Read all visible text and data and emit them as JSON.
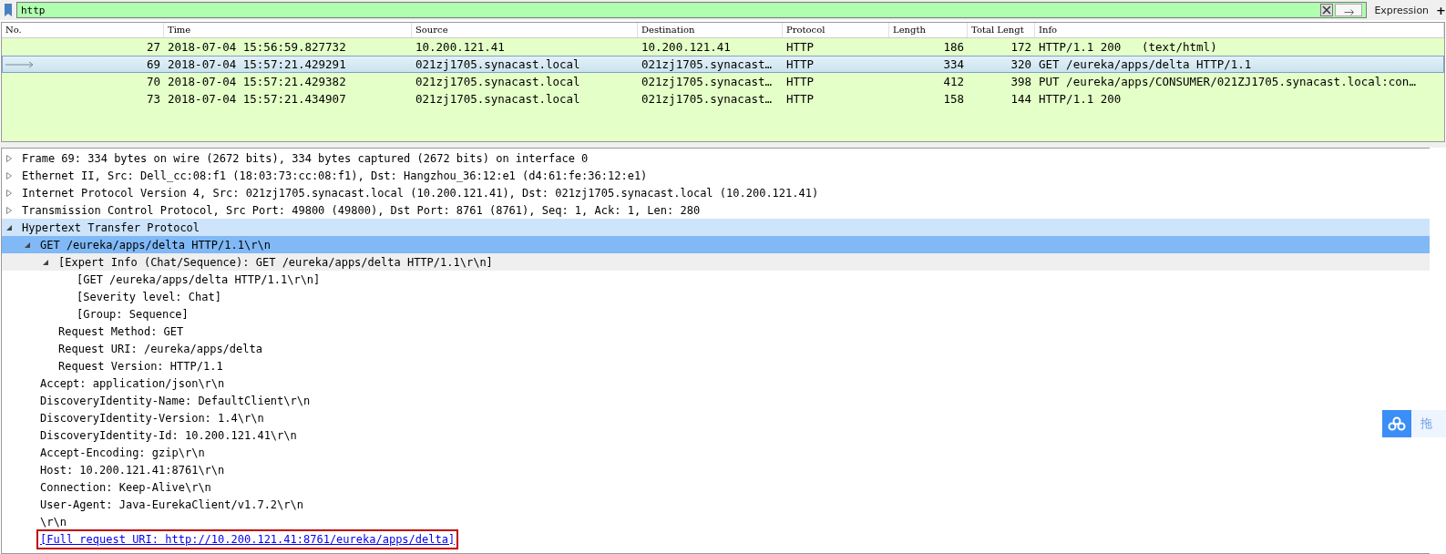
{
  "filter": {
    "value": "http",
    "expression_label": "Expression",
    "add_label": "+"
  },
  "packet_list": {
    "columns": [
      "No.",
      "Time",
      "Source",
      "Destination",
      "Protocol",
      "Length",
      "Total Lengt",
      "Info"
    ],
    "rows": [
      {
        "cells": [
          "27",
          "2018-07-04 15:56:59.827732",
          "10.200.121.41",
          "10.200.121.41",
          "HTTP",
          "186",
          "172",
          "HTTP/1.1 200   (text/html)"
        ],
        "selected": false
      },
      {
        "cells": [
          "69",
          "2018-07-04 15:57:21.429291",
          "021zj1705.synacast.local",
          "021zj1705.synacast…",
          "HTTP",
          "334",
          "320",
          "GET /eureka/apps/delta HTTP/1.1"
        ],
        "selected": true
      },
      {
        "cells": [
          "70",
          "2018-07-04 15:57:21.429382",
          "021zj1705.synacast.local",
          "021zj1705.synacast…",
          "HTTP",
          "412",
          "398",
          "PUT /eureka/apps/CONSUMER/021ZJ1705.synacast.local:con…"
        ],
        "selected": false
      },
      {
        "cells": [
          "73",
          "2018-07-04 15:57:21.434907",
          "021zj1705.synacast.local",
          "021zj1705.synacast…",
          "HTTP",
          "158",
          "144",
          "HTTP/1.1 200"
        ],
        "selected": false
      }
    ]
  },
  "details": [
    {
      "text": "Frame 69: 334 bytes on wire (2672 bits), 334 bytes captured (2672 bits) on interface 0",
      "expanded": false,
      "selected": false
    },
    {
      "text": "Ethernet II, Src: Dell_cc:08:f1 (18:03:73:cc:08:f1), Dst: Hangzhou_36:12:e1 (d4:61:fe:36:12:e1)",
      "expanded": false,
      "selected": false
    },
    {
      "text": "Internet Protocol Version 4, Src: 021zj1705.synacast.local (10.200.121.41), Dst: 021zj1705.synacast.local (10.200.121.41)",
      "expanded": false,
      "selected": false
    },
    {
      "text": "Transmission Control Protocol, Src Port: 49800 (49800), Dst Port: 8761 (8761), Seq: 1, Ack: 1, Len: 280",
      "expanded": false,
      "selected": false
    },
    {
      "text": "Hypertext Transfer Protocol",
      "expanded": true,
      "selected": false,
      "kind": "protocol",
      "children": [
        {
          "text": "GET /eureka/apps/delta HTTP/1.1\\r\\n",
          "expanded": true,
          "selected": true,
          "children": [
            {
              "text": "[Expert Info (Chat/Sequence): GET /eureka/apps/delta HTTP/1.1\\r\\n]",
              "expanded": true,
              "selected": false,
              "kind": "expert",
              "children": [
                {
                  "text": "[GET /eureka/apps/delta HTTP/1.1\\r\\n]",
                  "selected": false
                },
                {
                  "text": "[Severity level: Chat]",
                  "selected": false
                },
                {
                  "text": "[Group: Sequence]",
                  "selected": false
                }
              ]
            },
            {
              "text": "Request Method: GET",
              "selected": false
            },
            {
              "text": "Request URI: /eureka/apps/delta",
              "selected": false
            },
            {
              "text": "Request Version: HTTP/1.1",
              "selected": false
            }
          ]
        },
        {
          "text": "Accept: application/json\\r\\n",
          "selected": false
        },
        {
          "text": "DiscoveryIdentity-Name: DefaultClient\\r\\n",
          "selected": false
        },
        {
          "text": "DiscoveryIdentity-Version: 1.4\\r\\n",
          "selected": false
        },
        {
          "text": "DiscoveryIdentity-Id: 10.200.121.41\\r\\n",
          "selected": false
        },
        {
          "text": "Accept-Encoding: gzip\\r\\n",
          "selected": false
        },
        {
          "text": "Host: 10.200.121.41:8761\\r\\n",
          "selected": false
        },
        {
          "text": "Connection: Keep-Alive\\r\\n",
          "selected": false
        },
        {
          "text": "User-Agent: Java-EurekaClient/v1.7.2\\r\\n",
          "selected": false
        },
        {
          "text": "\\r\\n",
          "selected": false
        },
        {
          "text": "[Full request URI: http://10.200.121.41:8761/eureka/apps/delta]",
          "selected": false,
          "kind": "link",
          "outlined": true
        }
      ]
    }
  ],
  "side_widget": {
    "label": "拖"
  }
}
